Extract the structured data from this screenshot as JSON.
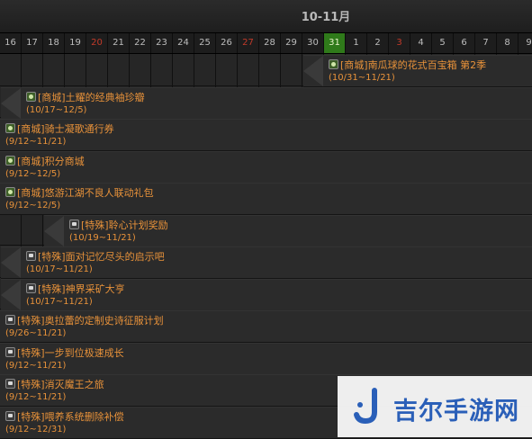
{
  "calendar": {
    "month_title": "10-11月",
    "days": [
      {
        "label": "16",
        "weekend": false,
        "today": false
      },
      {
        "label": "17",
        "weekend": false,
        "today": false
      },
      {
        "label": "18",
        "weekend": false,
        "today": false
      },
      {
        "label": "19",
        "weekend": false,
        "today": false
      },
      {
        "label": "20",
        "weekend": true,
        "today": false
      },
      {
        "label": "21",
        "weekend": false,
        "today": false
      },
      {
        "label": "22",
        "weekend": false,
        "today": false
      },
      {
        "label": "23",
        "weekend": false,
        "today": false
      },
      {
        "label": "24",
        "weekend": false,
        "today": false
      },
      {
        "label": "25",
        "weekend": false,
        "today": false
      },
      {
        "label": "26",
        "weekend": false,
        "today": false
      },
      {
        "label": "27",
        "weekend": true,
        "today": false
      },
      {
        "label": "28",
        "weekend": false,
        "today": false
      },
      {
        "label": "29",
        "weekend": false,
        "today": false
      },
      {
        "label": "30",
        "weekend": false,
        "today": false
      },
      {
        "label": "31",
        "weekend": false,
        "today": true
      },
      {
        "label": "1",
        "weekend": false,
        "today": false
      },
      {
        "label": "2",
        "weekend": false,
        "today": false
      },
      {
        "label": "3",
        "weekend": true,
        "today": false
      },
      {
        "label": "4",
        "weekend": false,
        "today": false
      },
      {
        "label": "5",
        "weekend": false,
        "today": false
      },
      {
        "label": "6",
        "weekend": false,
        "today": false
      },
      {
        "label": "7",
        "weekend": false,
        "today": false
      },
      {
        "label": "8",
        "weekend": false,
        "today": false
      },
      {
        "label": "9",
        "weekend": false,
        "today": false
      }
    ]
  },
  "events": [
    {
      "title": "[商城]南瓜球的花式百宝箱 第2季",
      "dates": "(10/31~11/21)",
      "kind": "shop",
      "start": "10/31",
      "arrow": true
    },
    {
      "title": "[商城]土耀的经典袖珍瓣",
      "dates": "(10/17~12/5)",
      "kind": "shop",
      "start": "10/17",
      "arrow": true
    },
    {
      "title": "[商城]骑士凝歌通行券",
      "dates": "(9/12~11/21)",
      "kind": "shop",
      "start": "9/12",
      "arrow": false
    },
    {
      "title": "[商城]积分商城",
      "dates": "(9/12~12/5)",
      "kind": "shop",
      "start": "9/12",
      "arrow": false
    },
    {
      "title": "[商城]悠游江湖不良人联动礼包",
      "dates": "(9/12~12/5)",
      "kind": "shop",
      "start": "9/12",
      "arrow": false
    },
    {
      "title": "[特殊]聆心计划奖励",
      "dates": "(10/19~11/21)",
      "kind": "special",
      "start": "10/19",
      "arrow": true
    },
    {
      "title": "[特殊]面对记忆尽头的启示吧",
      "dates": "(10/17~11/21)",
      "kind": "special",
      "start": "10/17",
      "arrow": true
    },
    {
      "title": "[特殊]神界采矿大亨",
      "dates": "(10/17~11/21)",
      "kind": "special",
      "start": "10/17",
      "arrow": true
    },
    {
      "title": "[特殊]奥拉蕾的定制史诗征服计划",
      "dates": "(9/26~11/21)",
      "kind": "special",
      "start": "9/26",
      "arrow": false
    },
    {
      "title": "[特殊]一步到位极速成长",
      "dates": "(9/12~11/21)",
      "kind": "special",
      "start": "9/12",
      "arrow": false
    },
    {
      "title": "[特殊]消灭魔王之旅",
      "dates": "(9/12~11/21)",
      "kind": "special",
      "start": "9/12",
      "arrow": false
    },
    {
      "title": "[特殊]喂养系统删除补偿",
      "dates": "(9/12~12/31)",
      "kind": "special",
      "start": "9/12",
      "arrow": false
    }
  ],
  "watermark": {
    "text": "吉尔手游网",
    "icon": "j-logo-icon"
  }
}
